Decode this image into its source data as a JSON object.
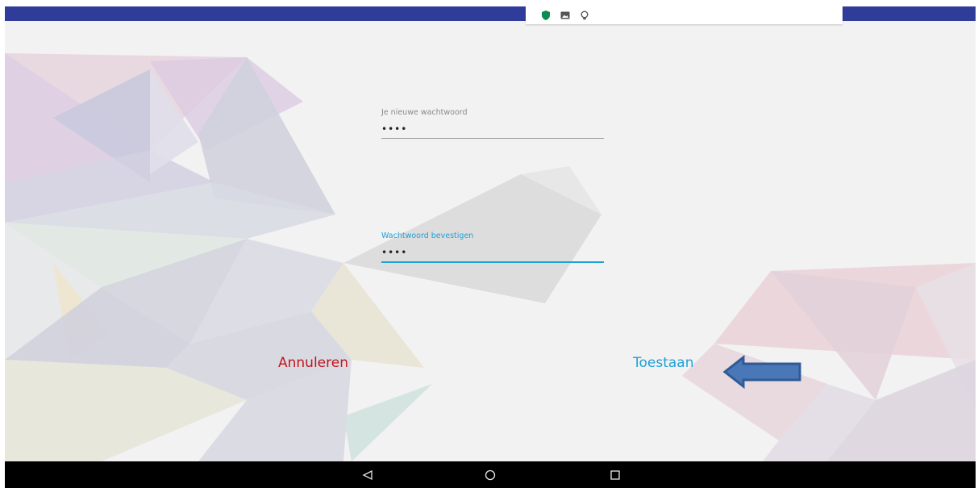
{
  "status_bar": {
    "icons": [
      "shield-icon",
      "image-icon",
      "lightbulb-icon"
    ],
    "bar_color": "#2f3c9a",
    "shield_color": "#0a8a55"
  },
  "form": {
    "new_password": {
      "label": "Je nieuwe wachtwoord",
      "value": "••••"
    },
    "confirm_password": {
      "label": "Wachtwoord bevestigen",
      "value": "••••"
    }
  },
  "actions": {
    "cancel_label": "Annuleren",
    "allow_label": "Toestaan",
    "cancel_color": "#c4161c",
    "allow_color": "#1ea0d8"
  },
  "annotation": {
    "arrow": "arrow-left-icon",
    "arrow_color": "#4a77b8"
  },
  "nav_bar": {
    "buttons": [
      "back-icon",
      "home-icon",
      "recent-apps-icon"
    ]
  }
}
